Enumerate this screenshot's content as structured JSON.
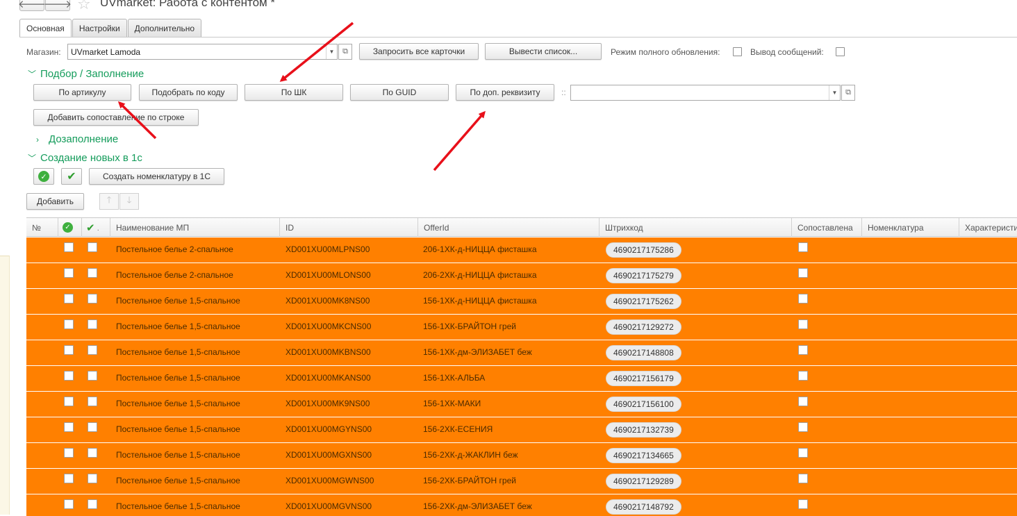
{
  "window": {
    "title": "UVmarket: Работа с контентом *",
    "back_symbol": "🡐",
    "forward_symbol": "🡒",
    "star_symbol": "☆"
  },
  "tabs": [
    {
      "label": "Основная",
      "active": true
    },
    {
      "label": "Настройки",
      "active": false
    },
    {
      "label": "Дополнительно",
      "active": false
    }
  ],
  "store": {
    "label": "Магазин:",
    "value": "UVmarket Lamoda",
    "request_cards_label": "Запросить все карточки",
    "show_list_label": "Вывести список...",
    "full_update_label": "Режим полного обновления:",
    "show_messages_label": "Вывод сообщений:"
  },
  "selection_group": {
    "title": "Подбор / Заполнение",
    "by_article_label": "По артикулу",
    "by_code_label": "Подобрать по коду",
    "by_barcode_label": "По ШК",
    "by_guid_label": "По GUID",
    "by_attribute_label": "По доп. реквизиту",
    "attribute_separator": "::",
    "attribute_value": "",
    "add_mapping_label": "Добавить сопоставление по строке"
  },
  "refill_group": {
    "title": "Дозаполнение"
  },
  "create_group": {
    "title": "Создание новых в 1с",
    "create_nomenclature_label": "Создать номенклатуру в 1С"
  },
  "toolbar": {
    "add_label": "Добавить",
    "up_symbol": "🡑",
    "down_symbol": "🡓"
  },
  "table": {
    "headers": {
      "num": "№",
      "name": "Наименование МП",
      "id": "ID",
      "offer_id": "OfferId",
      "barcode": "Штрихкод",
      "mapped": "Сопоставлена",
      "nomenclature": "Номенклатура",
      "characteristic": "Характеристика"
    },
    "row_color": "#ff8000",
    "rows": [
      {
        "name": "Постельное белье 2-спальное",
        "id": "XD001XU00MLPNS00",
        "offer_id": "206-1ХК-д-НИЦЦА фисташка",
        "barcode": "4690217175286"
      },
      {
        "name": "Постельное белье 2-спальное",
        "id": "XD001XU00MLONS00",
        "offer_id": "206-2ХК-д-НИЦЦА фисташка",
        "barcode": "4690217175279"
      },
      {
        "name": "Постельное белье 1,5-спальное",
        "id": "XD001XU00MK8NS00",
        "offer_id": "156-1ХК-д-НИЦЦА фисташка",
        "barcode": "4690217175262"
      },
      {
        "name": "Постельное белье 1,5-спальное",
        "id": "XD001XU00MKCNS00",
        "offer_id": "156-1ХК-БРАЙТОН грей",
        "barcode": "4690217129272"
      },
      {
        "name": "Постельное белье 1,5-спальное",
        "id": "XD001XU00MKBNS00",
        "offer_id": "156-1ХК-дм-ЭЛИЗАБЕТ беж",
        "barcode": "4690217148808"
      },
      {
        "name": "Постельное белье 1,5-спальное",
        "id": "XD001XU00MKANS00",
        "offer_id": "156-1ХК-АЛЬБА",
        "barcode": "4690217156179"
      },
      {
        "name": "Постельное белье 1,5-спальное",
        "id": "XD001XU00MK9NS00",
        "offer_id": "156-1ХК-МАКИ",
        "barcode": "4690217156100"
      },
      {
        "name": "Постельное белье 1,5-спальное",
        "id": "XD001XU00MGYNS00",
        "offer_id": "156-2ХК-ЕСЕНИЯ",
        "barcode": "4690217132739"
      },
      {
        "name": "Постельное белье 1,5-спальное",
        "id": "XD001XU00MGXNS00",
        "offer_id": "156-2ХК-д-ЖАКЛИН беж",
        "barcode": "4690217134665"
      },
      {
        "name": "Постельное белье 1,5-спальное",
        "id": "XD001XU00MGWNS00",
        "offer_id": "156-2ХК-БРАЙТОН грей",
        "barcode": "4690217129289"
      },
      {
        "name": "Постельное белье 1,5-спальное",
        "id": "XD001XU00MGVNS00",
        "offer_id": "156-2ХК-дм-ЭЛИЗАБЕТ беж",
        "barcode": "4690217148792"
      }
    ]
  },
  "annotation_color": "#e8101a"
}
